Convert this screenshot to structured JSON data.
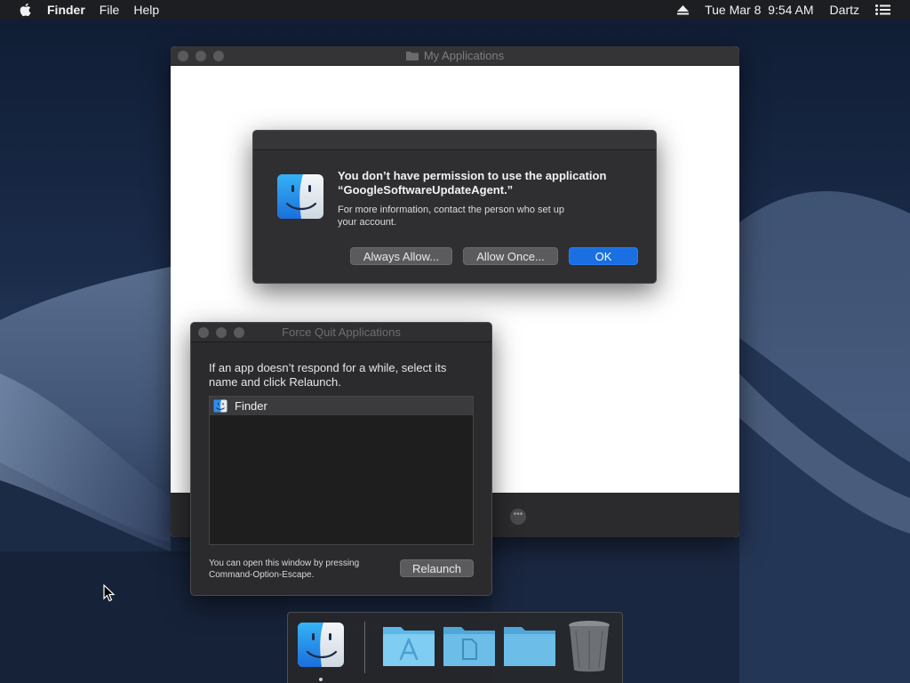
{
  "menubar": {
    "app_name": "Finder",
    "items": [
      "File",
      "Help"
    ],
    "clock": "Tue Mar 8  9:54 AM",
    "user": "Dartz"
  },
  "app_window": {
    "title": "My Applications"
  },
  "permission_dialog": {
    "title_line1": "You don’t have permission to use the application",
    "title_line2": "“GoogleSoftwareUpdateAgent.”",
    "message_line1": "For more information, contact the person who set up",
    "message_line2": "your account.",
    "buttons": {
      "always_allow": "Always Allow...",
      "allow_once": "Allow Once...",
      "ok": "OK"
    }
  },
  "force_quit": {
    "title": "Force Quit Applications",
    "instruction_line1": "If an app doesn’t respond for a while, select its",
    "instruction_line2": "name and click Relaunch.",
    "apps": [
      "Finder"
    ],
    "hint_line1": "You can open this window by pressing",
    "hint_line2": "Command-Option-Escape.",
    "relaunch_label": "Relaunch"
  },
  "dock": {
    "items": [
      "finder-icon",
      "applications-folder-icon",
      "documents-folder-icon",
      "folder-icon",
      "trash-icon"
    ]
  },
  "colors": {
    "accent": "#1a6fe3",
    "menubar": "#1e1e20",
    "dark_window": "#2b2b2d"
  }
}
